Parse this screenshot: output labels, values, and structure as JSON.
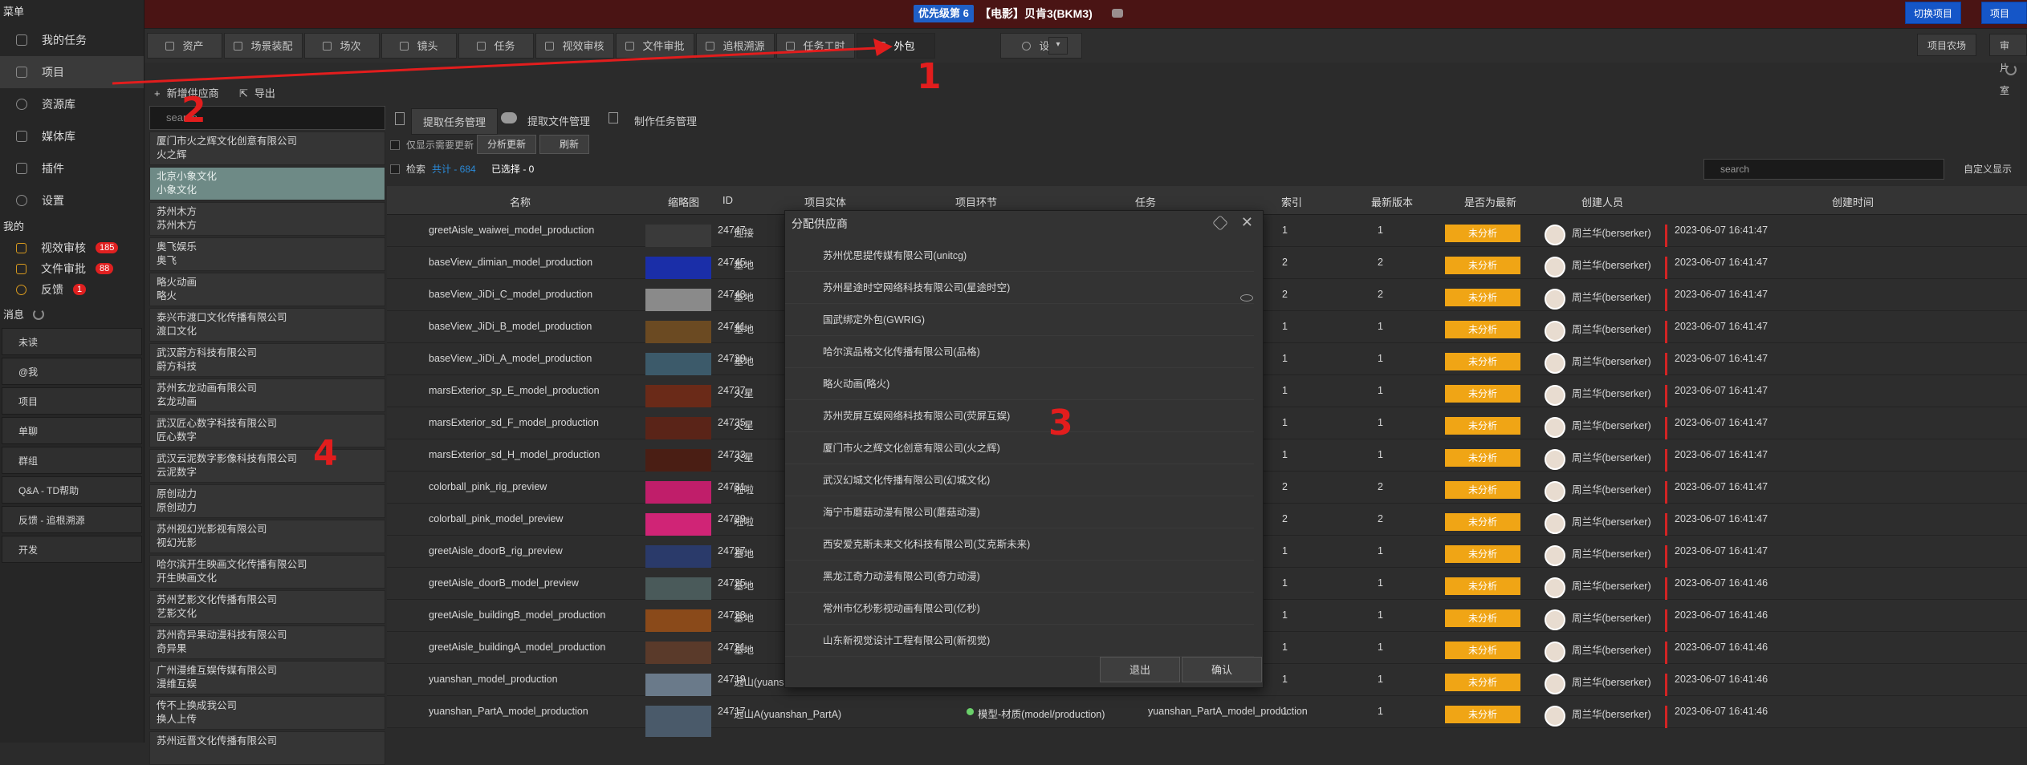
{
  "sidebar": {
    "menu_title": "菜单",
    "items": [
      {
        "label": "我的任务"
      },
      {
        "label": "项目"
      },
      {
        "label": "资源库"
      },
      {
        "label": "媒体库"
      },
      {
        "label": "插件"
      },
      {
        "label": "设置"
      }
    ],
    "mine_title": "我的",
    "mine": [
      {
        "label": "视效审核",
        "count": "185"
      },
      {
        "label": "文件审批",
        "count": "88"
      },
      {
        "label": "反馈",
        "count": "1"
      }
    ],
    "msg_title": "消息",
    "msgs": [
      {
        "label": "未读"
      },
      {
        "label": "@我"
      },
      {
        "label": "项目"
      },
      {
        "label": "单聊"
      },
      {
        "label": "群组"
      },
      {
        "label": "Q&A - TD帮助"
      },
      {
        "label": "反馈 - 追根溯源"
      },
      {
        "label": "开发"
      }
    ]
  },
  "header": {
    "badge": "优先级第 6",
    "title": "【电影】贝肯3(BKM3)",
    "switch_project": "切换项目",
    "project_right": "项目预"
  },
  "tabs": [
    {
      "label": "资产"
    },
    {
      "label": "场景装配"
    },
    {
      "label": "场次"
    },
    {
      "label": "镜头"
    },
    {
      "label": "任务"
    },
    {
      "label": "视效审核"
    },
    {
      "label": "文件审批"
    },
    {
      "label": "追根溯源"
    },
    {
      "label": "任务工时"
    },
    {
      "label": "外包"
    },
    {
      "label": "设置"
    }
  ],
  "right_buttons": {
    "farm": "项目农场",
    "approve": "审片室"
  },
  "toolbar": {
    "add_vendor": "新增供应商",
    "export": "导出"
  },
  "vendor_search_placeholder": "search",
  "vendors": [
    {
      "full": "厦门市火之辉文化创意有限公司",
      "short": "火之辉"
    },
    {
      "full": "北京小象文化",
      "short": "小象文化"
    },
    {
      "full": "苏州木方",
      "short": "苏州木方"
    },
    {
      "full": "奥飞娱乐",
      "short": "奥飞"
    },
    {
      "full": "略火动画",
      "short": "略火"
    },
    {
      "full": "泰兴市渡口文化传播有限公司",
      "short": "渡口文化"
    },
    {
      "full": "武汉蔚方科技有限公司",
      "short": "蔚方科技"
    },
    {
      "full": "苏州玄龙动画有限公司",
      "short": "玄龙动画"
    },
    {
      "full": "武汉匠心数字科技有限公司",
      "short": "匠心数字"
    },
    {
      "full": "武汉云泥数字影像科技有限公司",
      "short": "云泥数字"
    },
    {
      "full": "原创动力",
      "short": "原创动力"
    },
    {
      "full": "苏州视幻光影视有限公司",
      "short": "视幻光影"
    },
    {
      "full": "哈尔滨开生映画文化传播有限公司",
      "short": "开生映画文化"
    },
    {
      "full": "苏州艺影文化传播有限公司",
      "short": "艺影文化"
    },
    {
      "full": "苏州奇异果动漫科技有限公司",
      "short": "奇异果"
    },
    {
      "full": "广州漫维互娱传媒有限公司",
      "short": "漫维互娱"
    },
    {
      "full": "传不上换成我公司",
      "short": "换人上传"
    },
    {
      "full": "苏州远晋文化传播有限公司",
      "short": ""
    }
  ],
  "main": {
    "subtabs": {
      "extract": "提取任务管理",
      "files": "提取文件管理",
      "make": "制作任务管理"
    },
    "only_update": "仅显示需要更新",
    "analyze": "分析更新",
    "refresh": "刷新",
    "search_lbl": "检索",
    "total": "共计 - 684",
    "selected": "已选择 - 0",
    "search_placeholder": "search",
    "custom_display": "自定义显示"
  },
  "table": {
    "headers": {
      "name": "名称",
      "thumb": "缩略图",
      "id": "ID",
      "entity": "项目实体",
      "step": "项目环节",
      "task": "任务",
      "index": "索引",
      "ver": "最新版本",
      "latest": "是否为最新",
      "creator": "创建人员",
      "ctime": "创建时间"
    },
    "rows": [
      {
        "name": "greetAisle_waiwei_model_production",
        "id": "24747",
        "ent": "迎接",
        "idx": "1",
        "ver": "1",
        "st": "未分析",
        "cr": "周兰华(berserker)",
        "t": "2023-06-07 16:41:47",
        "thumb": "#3a3a3a"
      },
      {
        "name": "baseView_dimian_model_production",
        "id": "24745",
        "ent": "基地",
        "idx": "2",
        "ver": "2",
        "st": "未分析",
        "cr": "周兰华(berserker)",
        "t": "2023-06-07 16:41:47",
        "thumb": "#1a2ea8"
      },
      {
        "name": "baseView_JiDi_C_model_production",
        "id": "24743",
        "ent": "基地",
        "idx": "2",
        "ver": "2",
        "st": "未分析",
        "cr": "周兰华(berserker)",
        "t": "2023-06-07 16:41:47",
        "thumb": "#8a8a8a"
      },
      {
        "name": "baseView_JiDi_B_model_production",
        "id": "24741",
        "ent": "基地",
        "idx": "1",
        "ver": "1",
        "st": "未分析",
        "cr": "周兰华(berserker)",
        "t": "2023-06-07 16:41:47",
        "thumb": "#6b4a22"
      },
      {
        "name": "baseView_JiDi_A_model_production",
        "id": "24739",
        "ent": "基地",
        "idx": "1",
        "ver": "1",
        "st": "未分析",
        "cr": "周兰华(berserker)",
        "t": "2023-06-07 16:41:47",
        "thumb": "#3c5a6a"
      },
      {
        "name": "marsExterior_sp_E_model_production",
        "id": "24737",
        "ent": "火星",
        "idx": "1",
        "ver": "1",
        "st": "未分析",
        "cr": "周兰华(berserker)",
        "t": "2023-06-07 16:41:47",
        "thumb": "#6a2a18"
      },
      {
        "name": "marsExterior_sd_F_model_production",
        "id": "24735",
        "ent": "火星",
        "idx": "1",
        "ver": "1",
        "st": "未分析",
        "cr": "周兰华(berserker)",
        "t": "2023-06-07 16:41:47",
        "thumb": "#5a2418"
      },
      {
        "name": "marsExterior_sd_H_model_production",
        "id": "24733",
        "ent": "火星",
        "idx": "1",
        "ver": "1",
        "st": "未分析",
        "cr": "周兰华(berserker)",
        "t": "2023-06-07 16:41:47",
        "thumb": "#4a1e14"
      },
      {
        "name": "colorball_pink_rig_preview",
        "id": "24731",
        "ent": "啦啦",
        "idx": "2",
        "ver": "2",
        "st": "未分析",
        "cr": "周兰华(berserker)",
        "t": "2023-06-07 16:41:47",
        "thumb": "#c01e6a"
      },
      {
        "name": "colorball_pink_model_preview",
        "id": "24729",
        "ent": "啦啦",
        "idx": "2",
        "ver": "2",
        "st": "未分析",
        "cr": "周兰华(berserker)",
        "t": "2023-06-07 16:41:47",
        "thumb": "#d02476"
      },
      {
        "name": "greetAisle_doorB_rig_preview",
        "id": "24727",
        "ent": "基地",
        "idx": "1",
        "ver": "1",
        "st": "未分析",
        "cr": "周兰华(berserker)",
        "t": "2023-06-07 16:41:47",
        "thumb": "#2a3a6a"
      },
      {
        "name": "greetAisle_doorB_model_preview",
        "id": "24725",
        "ent": "基地",
        "idx": "1",
        "ver": "1",
        "st": "未分析",
        "cr": "周兰华(berserker)",
        "t": "2023-06-07 16:41:46",
        "thumb": "#4a5a5a"
      },
      {
        "name": "greetAisle_buildingB_model_production",
        "id": "24723",
        "ent": "基地",
        "idx": "1",
        "ver": "1",
        "st": "未分析",
        "cr": "周兰华(berserker)",
        "t": "2023-06-07 16:41:46",
        "thumb": "#8a4a1a"
      },
      {
        "name": "greetAisle_buildingA_model_production",
        "id": "24721",
        "ent": "基地",
        "idx": "1",
        "ver": "1",
        "st": "未分析",
        "cr": "周兰华(berserker)",
        "t": "2023-06-07 16:41:46",
        "thumb": "#5a3a2a"
      },
      {
        "name": "yuanshan_model_production",
        "id": "24719",
        "ent": "远山(yuanshan)",
        "idx": "1",
        "ver": "1",
        "st": "未分析",
        "cr": "周兰华(berserker)",
        "t": "2023-06-07 16:41:46",
        "thumb": "#6a7a8a"
      },
      {
        "name": "yuanshan_PartA_model_production",
        "id": "24717",
        "ent": "远山A(yuanshan_PartA)",
        "step": "模型-材质(model/production)",
        "task": "yuanshan_PartA_model_production",
        "idx": "1",
        "ver": "1",
        "st": "未分析",
        "cr": "周兰华(berserker)",
        "t": "2023-06-07 16:41:46",
        "thumb": "#4a5a6a"
      }
    ]
  },
  "dialog": {
    "title": "分配供应商",
    "items": [
      "苏州优思提传媒有限公司(unitcg)",
      "苏州星途时空网络科技有限公司(星途时空)",
      "国武绑定外包(GWRIG)",
      "哈尔滨品格文化传播有限公司(品格)",
      "略火动画(略火)",
      "苏州荧屏互娱网络科技有限公司(荧屏互娱)",
      "厦门市火之辉文化创意有限公司(火之辉)",
      "武汉幻城文化传播有限公司(幻城文化)",
      "海宁市蘑菇动漫有限公司(蘑菇动漫)",
      "西安爱克斯未来文化科技有限公司(艾克斯未来)",
      "黑龙江奇力动漫有限公司(奇力动漫)",
      "常州市亿秒影视动画有限公司(亿秒)",
      "山东新视觉设计工程有限公司(新视觉)"
    ],
    "exit": "退出",
    "confirm": "确认"
  },
  "annotations": [
    "1",
    "2",
    "3",
    "4"
  ]
}
